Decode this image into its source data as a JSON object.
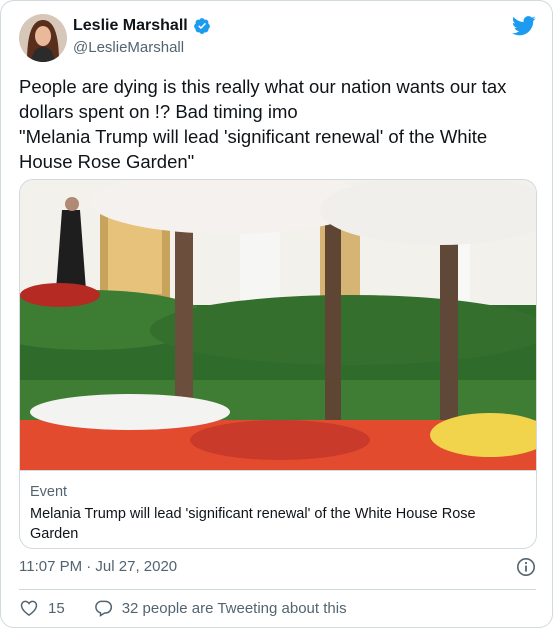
{
  "author": {
    "display_name": "Leslie Marshall",
    "handle": "@LeslieMarshall",
    "verified": true,
    "avatar_icon": "profile-photo"
  },
  "tweet": {
    "text_line1": "People are dying is this really what our nation wants our tax dollars spent on !? Bad timing imo",
    "text_line2": "\"Melania Trump will lead 'significant renewal' of the White House Rose Garden\""
  },
  "card": {
    "image_icon": "rose-garden-photo",
    "kicker": "Event",
    "title": "Melania Trump will lead 'significant renewal' of the White House Rose Garden"
  },
  "meta": {
    "timestamp": "11:07 PM · Jul 27, 2020"
  },
  "actions": {
    "like_count": "15",
    "conversation": "32 people are Tweeting about this"
  },
  "colors": {
    "brand_blue": "#1d9bf0",
    "text_secondary": "#536471",
    "border": "#cfd9de"
  }
}
